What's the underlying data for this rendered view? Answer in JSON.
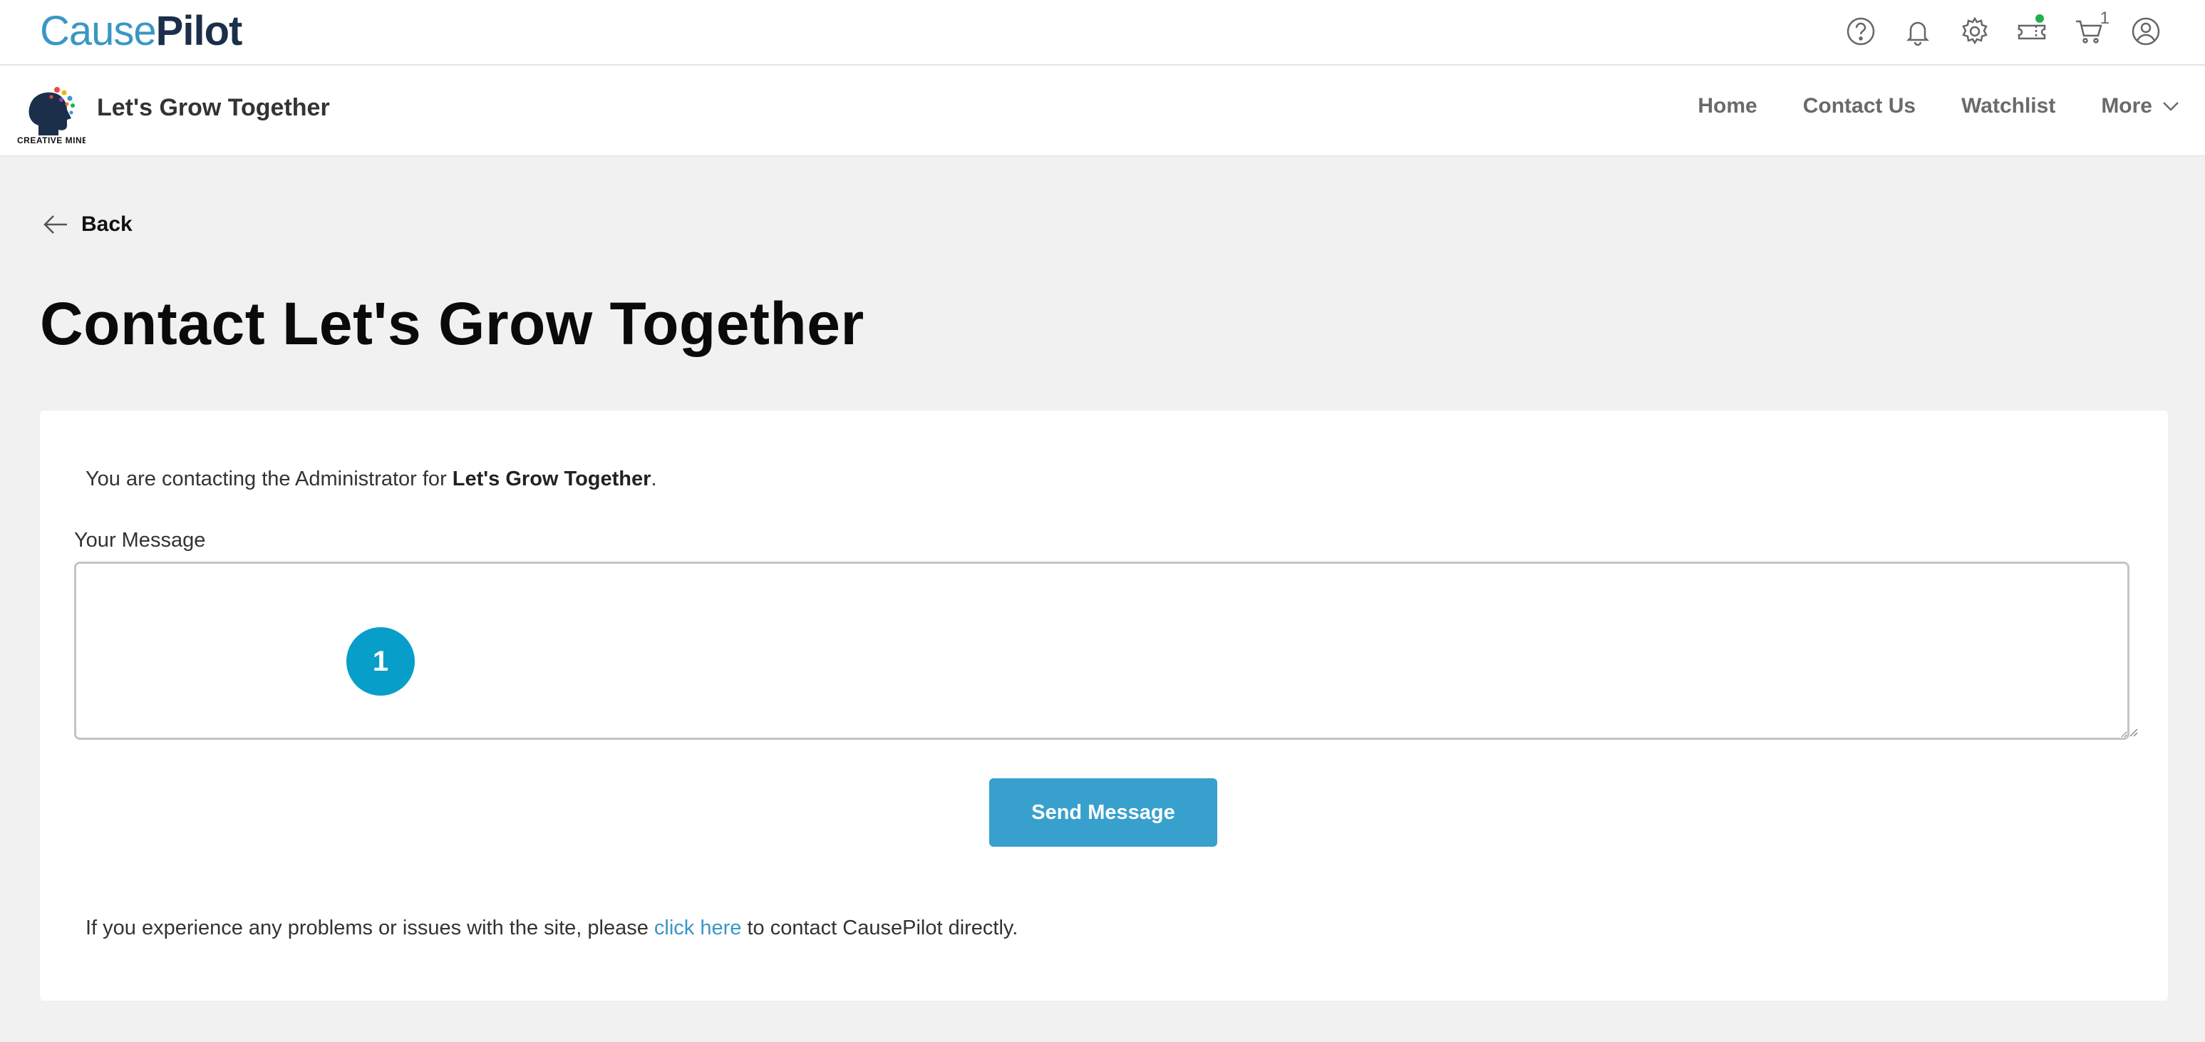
{
  "brand": {
    "part1": "Cause",
    "part2": "Pilot"
  },
  "top_icons": [
    {
      "name": "help-icon"
    },
    {
      "name": "bell-icon"
    },
    {
      "name": "gear-icon"
    },
    {
      "name": "ticket-icon",
      "status_dot_color": "#1eb24b"
    },
    {
      "name": "cart-icon",
      "count": "1"
    },
    {
      "name": "user-icon"
    }
  ],
  "org": {
    "logo_caption": "CREATIVE MINE",
    "title": "Let's Grow Together",
    "nav": {
      "home": "Home",
      "contact": "Contact Us",
      "watchlist": "Watchlist",
      "more": "More"
    }
  },
  "back_label": "Back",
  "page_title": "Contact Let's Grow Together",
  "form": {
    "intro_prefix": "You are contacting the Administrator for ",
    "intro_org": "Let's Grow Together",
    "intro_suffix": ".",
    "message_label": "Your Message",
    "message_value": "",
    "marker": "1",
    "send_label": "Send Message"
  },
  "footer": {
    "prefix": "If you experience any problems or issues with the site, please ",
    "link": "click here",
    "suffix": " to contact CausePilot directly."
  },
  "colors": {
    "accent": "#38a0cd",
    "brand_dark": "#1c2f4a",
    "marker": "#079ec9"
  }
}
